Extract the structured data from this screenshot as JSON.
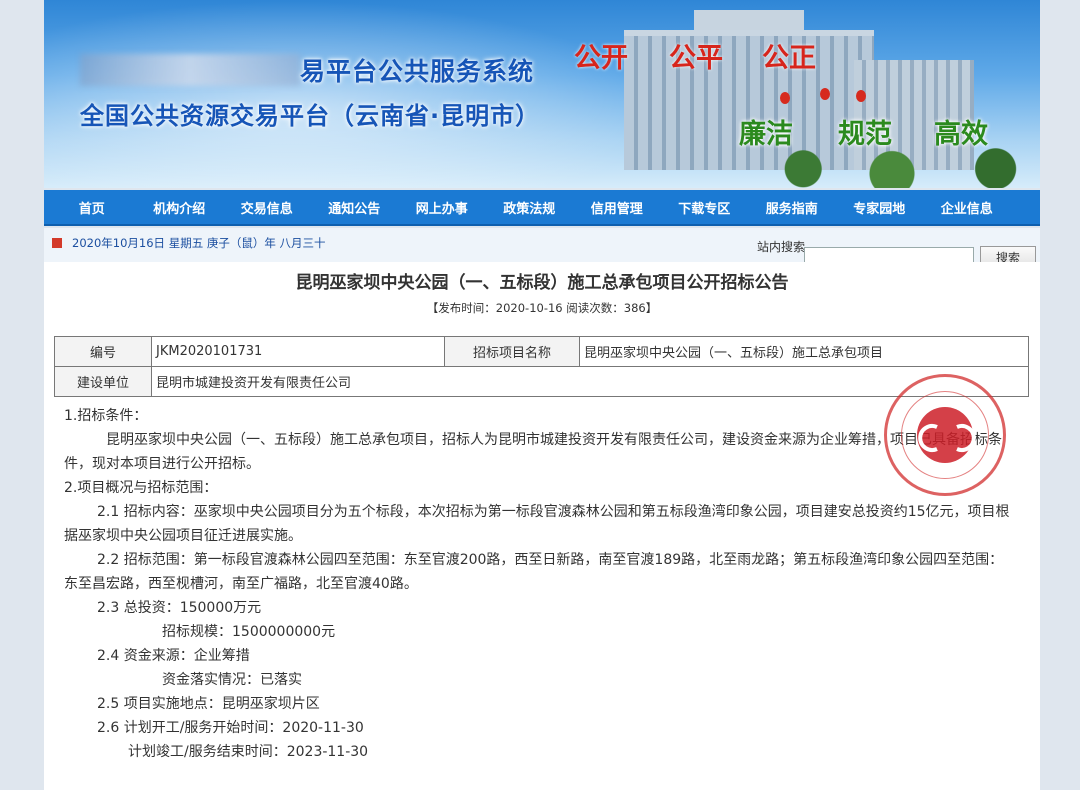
{
  "banner": {
    "title_line1": "易平台公共服务系统",
    "title_line2": "全国公共资源交易平台（云南省·昆明市）",
    "slogans_red": [
      "公开",
      "公平",
      "公正"
    ],
    "slogans_green": [
      "廉洁",
      "规范",
      "高效"
    ]
  },
  "nav": {
    "items": [
      "首页",
      "机构介绍",
      "交易信息",
      "通知公告",
      "网上办事",
      "政策法规",
      "信用管理",
      "下载专区",
      "服务指南",
      "专家园地",
      "企业信息"
    ]
  },
  "datebar": {
    "date_text": "2020年10月16日  星期五  庚子（鼠）年 八月三十",
    "search_label": "站内搜索",
    "search_value": "",
    "search_button": "搜索"
  },
  "notice": {
    "title": "昆明巫家坝中央公园（一、五标段）施工总承包项目公开招标公告",
    "meta": "【发布时间：2020-10-16  阅读次数：386】",
    "table": {
      "number_label": "编号",
      "number_value": "JKM2020101731",
      "project_label": "招标项目名称",
      "project_value": "昆明巫家坝中央公园（一、五标段）施工总承包项目",
      "builder_label": "建设单位",
      "builder_value": "昆明市城建投资开发有限责任公司"
    },
    "seal_text": "公共资源交易平台 · 存证标识",
    "sections": {
      "s1_title": "1.招标条件：",
      "s1_body": "昆明巫家坝中央公园（一、五标段）施工总承包项目，招标人为昆明市城建投资开发有限责任公司，建设资金来源为企业筹措，项目已具备招标条件，现对本项目进行公开招标。",
      "s2_title": "2.项目概况与招标范围：",
      "s2_1": "2.1 招标内容：巫家坝中央公园项目分为五个标段，本次招标为第一标段官渡森林公园和第五标段渔湾印象公园，项目建安总投资约15亿元，项目根据巫家坝中央公园项目征迁进展实施。",
      "s2_2": "2.2 招标范围：第一标段官渡森林公园四至范围：东至官渡200路，西至日新路，南至官渡189路，北至雨龙路；第五标段渔湾印象公园四至范围：东至昌宏路，西至枧槽河，南至广福路，北至官渡40路。",
      "s2_3": "2.3 总投资：150000万元",
      "s2_3b": "招标规模：1500000000元",
      "s2_4": "2.4 资金来源：企业筹措",
      "s2_4b": "资金落实情况：已落实",
      "s2_5": "2.5 项目实施地点：昆明巫家坝片区",
      "s2_6": "2.6 计划开工/服务开始时间：2020-11-30",
      "s2_6b": "计划竣工/服务结束时间：2023-11-30"
    }
  },
  "colors": {
    "nav_bg": "#1b7ad3",
    "title_blue": "#1655b7",
    "slogan_red": "#d7251c",
    "slogan_green": "#2b8a1e",
    "seal_red": "#d22d2d"
  }
}
